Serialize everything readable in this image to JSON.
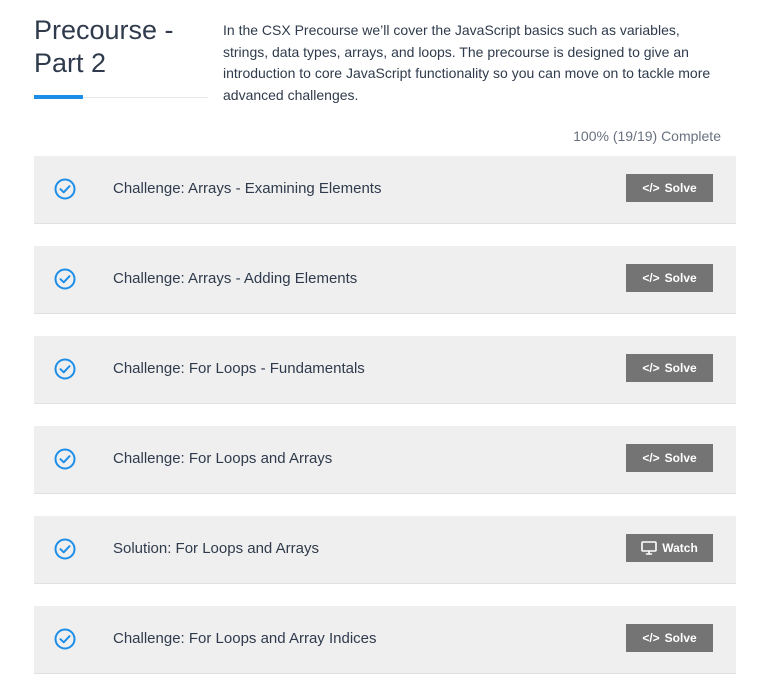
{
  "header": {
    "title": "Precourse -\nPart 2",
    "description": "In the CSX Precourse we’ll cover the JavaScript basics such as variables, strings, data types, arrays, and loops. The precourse is designed to give an introduction to core JavaScript functionality so you can move on to tackle more advanced challenges."
  },
  "progress": {
    "text": "100% (19/19) Complete",
    "percent": 100,
    "completed": 19,
    "total": 19
  },
  "colors": {
    "accent": "#1d8ee8",
    "check": "#1d8ee8",
    "button_bg": "#747474",
    "card_bg": "#efefef"
  },
  "lessons": [
    {
      "title": "Challenge: Arrays - Examining Elements",
      "status_icon": "check-circle-icon",
      "action_icon": "code-icon",
      "action_label": "Solve"
    },
    {
      "title": "Challenge: Arrays - Adding Elements",
      "status_icon": "check-circle-icon",
      "action_icon": "code-icon",
      "action_label": "Solve"
    },
    {
      "title": "Challenge: For Loops - Fundamentals",
      "status_icon": "check-circle-icon",
      "action_icon": "code-icon",
      "action_label": "Solve"
    },
    {
      "title": "Challenge: For Loops and Arrays",
      "status_icon": "check-circle-icon",
      "action_icon": "code-icon",
      "action_label": "Solve"
    },
    {
      "title": "Solution: For Loops and Arrays",
      "status_icon": "check-circle-icon",
      "action_icon": "monitor-icon",
      "action_label": "Watch"
    },
    {
      "title": "Challenge: For Loops and Array Indices",
      "status_icon": "check-circle-icon",
      "action_icon": "code-icon",
      "action_label": "Solve"
    }
  ]
}
